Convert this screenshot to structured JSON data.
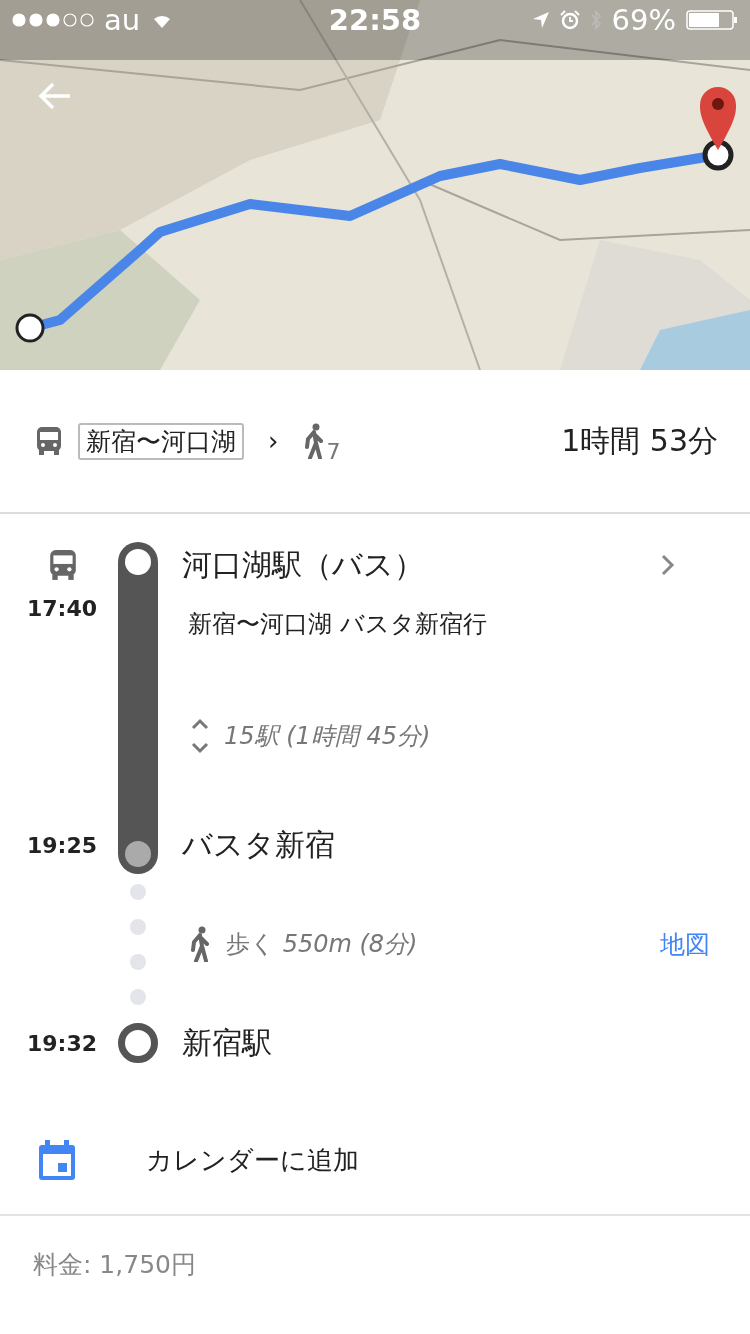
{
  "status_bar": {
    "carrier": "au",
    "time": "22:58",
    "battery": "69%"
  },
  "summary": {
    "line_badge": "新宿〜河口湖",
    "separator": "›",
    "walk_count": "7",
    "duration": "1時間 53分"
  },
  "transit": {
    "departure_stop": "河口湖駅（バス）",
    "departure_time": "17:40",
    "line_name": "新宿〜河口湖  バスタ新宿行",
    "stops": "15駅 (1時間 45分)",
    "arrival_time": "19:25",
    "arrival_stop": "バスタ新宿"
  },
  "walk": {
    "text": "歩く *550m (8分)*",
    "map_link": "地図"
  },
  "destination": {
    "time": "19:32",
    "stop": "新宿駅"
  },
  "calendar": "カレンダーに追加",
  "fare": "料金: 1,750円"
}
